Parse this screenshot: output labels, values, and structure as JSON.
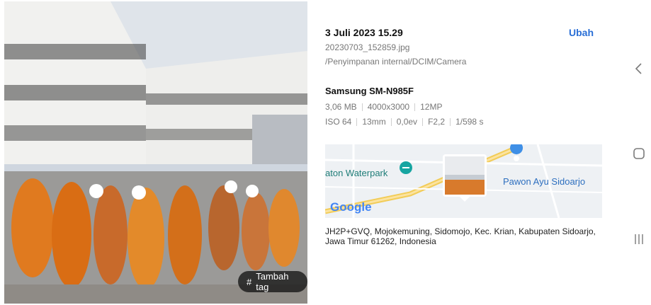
{
  "photo": {
    "add_tag_label": "Tambah tag"
  },
  "details": {
    "date": "3 Juli 2023 15.29",
    "edit_label": "Ubah",
    "filename": "20230703_152859.jpg",
    "path": "/Penyimpanan internal/DCIM/Camera",
    "device": "Samsung SM-N985F",
    "file_info": [
      "3,06 MB",
      "4000x3000",
      "12MP"
    ],
    "camera_info": [
      "ISO 64",
      "13mm",
      "0,0ev",
      "F2,2",
      "1/598 s"
    ],
    "map": {
      "place_left": "aton Waterpark",
      "place_right": "Pawon Ayu Sidoarjo",
      "logo": "Google"
    },
    "address": "JH2P+GVQ, Mojokemuning, Sidomojo, Kec. Krian, Kabupaten Sidoarjo, Jawa Timur 61262, Indonesia"
  },
  "nav": {
    "icons": [
      "back-chevron-icon",
      "home-icon",
      "recent-apps-icon"
    ]
  },
  "colors": {
    "accent": "#2a6fd6",
    "secondary_text": "#777777"
  }
}
